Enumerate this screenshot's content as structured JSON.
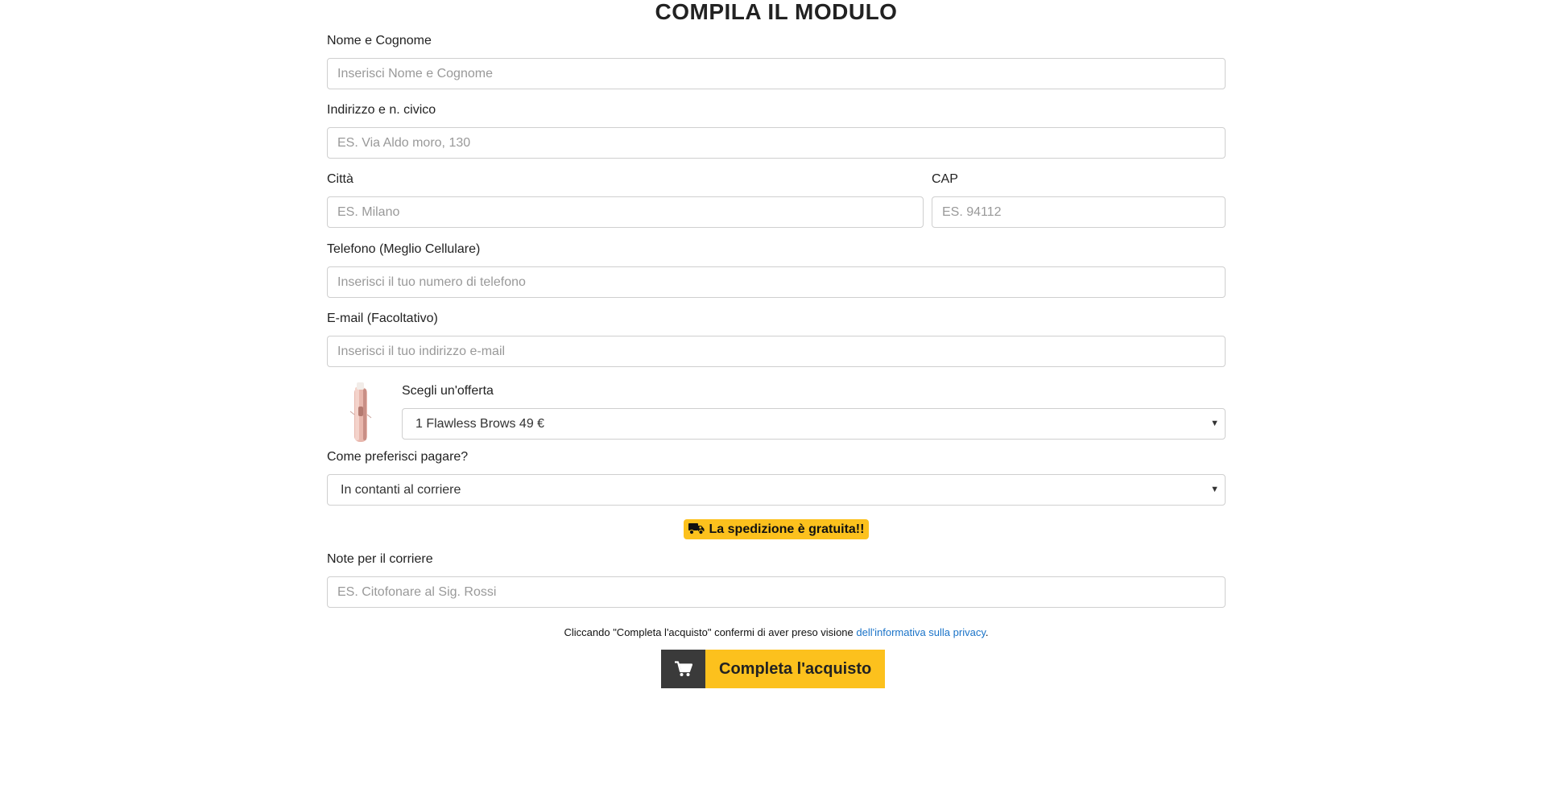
{
  "form": {
    "title": "COMPILA IL MODULO",
    "name": {
      "label": "Nome e Cognome",
      "placeholder": "Inserisci Nome e Cognome"
    },
    "address": {
      "label": "Indirizzo e n. civico",
      "placeholder": "ES. Via Aldo moro, 130"
    },
    "city": {
      "label": "Città",
      "placeholder": "ES. Milano"
    },
    "cap": {
      "label": "CAP",
      "placeholder": "ES. 94112"
    },
    "phone": {
      "label": "Telefono (Meglio Cellulare)",
      "placeholder": "Inserisci il tuo numero di telefono"
    },
    "email": {
      "label": "E-mail (Facoltativo)",
      "placeholder": "Inserisci il tuo indirizzo e-mail"
    },
    "offer": {
      "label": "Scegli un'offerta",
      "selected": "1 Flawless Brows 49 €"
    },
    "payment": {
      "label": "Come preferisci pagare?",
      "selected": "In contanti al corriere"
    },
    "shipping_badge": "La spedizione è gratuita!!",
    "notes": {
      "label": "Note per il corriere",
      "placeholder": "ES. Citofonare al Sig. Rossi"
    },
    "privacy": {
      "text": "Cliccando \"Completa l'acquisto\" confermi di aver preso visione ",
      "link": "dell'informativa sulla privacy",
      "end": "."
    },
    "submit_label": "Completa l'acquisto"
  },
  "icons": {
    "shipping": "truck-icon",
    "submit": "shopping-cart-icon",
    "select": "caret-down-icon"
  },
  "colors": {
    "accent": "#fcc11d",
    "cta_icon_bg": "#3a3a3a",
    "link": "#1a73c8"
  }
}
